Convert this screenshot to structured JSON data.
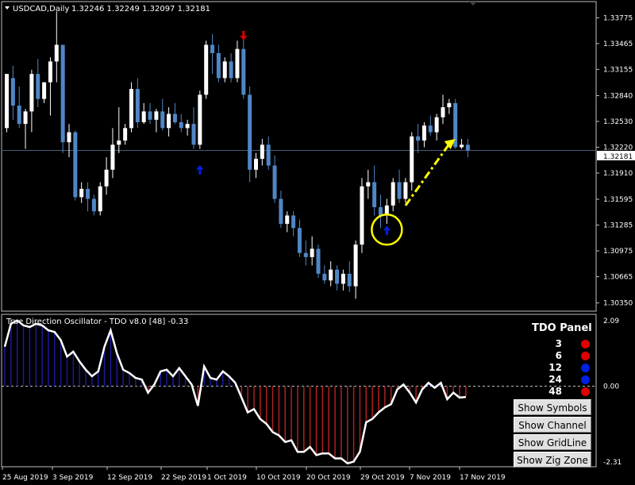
{
  "header": {
    "symbol": "USDCAD,Daily",
    "ohlc": "1.32246 1.32249 1.32097 1.32181"
  },
  "chart_data": [
    {
      "type": "candlestick",
      "title": "USDCAD,Daily",
      "ylim": [
        1.3027,
        1.3395
      ],
      "y_ticks": [
        "1.33775",
        "1.33465",
        "1.33155",
        "1.32840",
        "1.32530",
        "1.32220",
        "1.31910",
        "1.31595",
        "1.31285",
        "1.30975",
        "1.30665",
        "1.30350"
      ],
      "current_price": "1.32181",
      "x_ticks": [
        "25 Aug 2019",
        "3 Sep 2019",
        "12 Sep 2019",
        "22 Sep 2019",
        "1 Oct 2019",
        "10 Oct 2019",
        "20 Oct 2019",
        "29 Oct 2019",
        "7 Nov 2019",
        "17 Nov 2019"
      ],
      "candles": [
        [
          1.3245,
          1.3305,
          1.324,
          1.331
        ],
        [
          1.3305,
          1.332,
          1.3255,
          1.3272
        ],
        [
          1.3272,
          1.3295,
          1.3245,
          1.325
        ],
        [
          1.325,
          1.3268,
          1.322,
          1.3265
        ],
        [
          1.3265,
          1.3315,
          1.324,
          1.331
        ],
        [
          1.331,
          1.3328,
          1.327,
          1.328
        ],
        [
          1.328,
          1.33,
          1.3275,
          1.33
        ],
        [
          1.33,
          1.333,
          1.326,
          1.3325
        ],
        [
          1.3325,
          1.3385,
          1.33,
          1.3345
        ],
        [
          1.3345,
          1.3345,
          1.3215,
          1.3228
        ],
        [
          1.3228,
          1.325,
          1.321,
          1.324
        ],
        [
          1.324,
          1.3242,
          1.3158,
          1.3162
        ],
        [
          1.3162,
          1.318,
          1.3155,
          1.3172
        ],
        [
          1.3172,
          1.318,
          1.3145,
          1.316
        ],
        [
          1.316,
          1.3165,
          1.314,
          1.3145
        ],
        [
          1.3145,
          1.318,
          1.314,
          1.3175
        ],
        [
          1.3175,
          1.321,
          1.3165,
          1.3195
        ],
        [
          1.3195,
          1.3245,
          1.3185,
          1.3225
        ],
        [
          1.3225,
          1.327,
          1.3215,
          1.323
        ],
        [
          1.323,
          1.325,
          1.3225,
          1.3245
        ],
        [
          1.3245,
          1.33,
          1.324,
          1.3292
        ],
        [
          1.3292,
          1.3305,
          1.3245,
          1.3252
        ],
        [
          1.3252,
          1.3275,
          1.325,
          1.3265
        ],
        [
          1.3265,
          1.3275,
          1.325,
          1.3255
        ],
        [
          1.3255,
          1.3268,
          1.324,
          1.3265
        ],
        [
          1.3265,
          1.328,
          1.3242,
          1.3245
        ],
        [
          1.3245,
          1.327,
          1.3235,
          1.3262
        ],
        [
          1.3262,
          1.3275,
          1.325,
          1.3252
        ],
        [
          1.3252,
          1.3262,
          1.324,
          1.3245
        ],
        [
          1.3245,
          1.3255,
          1.3236,
          1.325
        ],
        [
          1.325,
          1.327,
          1.322,
          1.3225
        ],
        [
          1.3225,
          1.329,
          1.322,
          1.3285
        ],
        [
          1.3285,
          1.335,
          1.328,
          1.3345
        ],
        [
          1.3345,
          1.3358,
          1.331,
          1.3335
        ],
        [
          1.3335,
          1.3345,
          1.33,
          1.3305
        ],
        [
          1.3305,
          1.333,
          1.33,
          1.3325
        ],
        [
          1.3325,
          1.3335,
          1.33,
          1.3305
        ],
        [
          1.3305,
          1.335,
          1.33,
          1.334
        ],
        [
          1.334,
          1.3355,
          1.328,
          1.3285
        ],
        [
          1.3285,
          1.3295,
          1.318,
          1.3195
        ],
        [
          1.3195,
          1.3215,
          1.3185,
          1.3208
        ],
        [
          1.3208,
          1.3232,
          1.32,
          1.3225
        ],
        [
          1.3225,
          1.3235,
          1.3195,
          1.32
        ],
        [
          1.32,
          1.3212,
          1.3155,
          1.316
        ],
        [
          1.316,
          1.317,
          1.3125,
          1.313
        ],
        [
          1.313,
          1.3145,
          1.312,
          1.314
        ],
        [
          1.314,
          1.3145,
          1.3115,
          1.3125
        ],
        [
          1.3125,
          1.3135,
          1.309,
          1.3095
        ],
        [
          1.3095,
          1.311,
          1.308,
          1.309
        ],
        [
          1.309,
          1.3115,
          1.308,
          1.31
        ],
        [
          1.31,
          1.3105,
          1.3065,
          1.307
        ],
        [
          1.307,
          1.308,
          1.3058,
          1.3062
        ],
        [
          1.3062,
          1.3085,
          1.3055,
          1.3075
        ],
        [
          1.3075,
          1.308,
          1.305,
          1.3058
        ],
        [
          1.3058,
          1.3075,
          1.305,
          1.307
        ],
        [
          1.307,
          1.3085,
          1.3048,
          1.3055
        ],
        [
          1.3055,
          1.311,
          1.304,
          1.3105
        ],
        [
          1.3105,
          1.3185,
          1.3095,
          1.3175
        ],
        [
          1.3175,
          1.3195,
          1.316,
          1.318
        ],
        [
          1.318,
          1.32,
          1.314,
          1.315
        ],
        [
          1.315,
          1.3165,
          1.3125,
          1.314
        ],
        [
          1.314,
          1.316,
          1.313,
          1.3152
        ],
        [
          1.3152,
          1.3185,
          1.3145,
          1.318
        ],
        [
          1.318,
          1.3195,
          1.3155,
          1.316
        ],
        [
          1.316,
          1.3185,
          1.3155,
          1.318
        ],
        [
          1.318,
          1.324,
          1.317,
          1.3235
        ],
        [
          1.3235,
          1.325,
          1.3215,
          1.323
        ],
        [
          1.323,
          1.3252,
          1.3222,
          1.3248
        ],
        [
          1.3248,
          1.326,
          1.3236,
          1.324
        ],
        [
          1.324,
          1.3262,
          1.323,
          1.3258
        ],
        [
          1.3258,
          1.3285,
          1.325,
          1.327
        ],
        [
          1.327,
          1.328,
          1.3262,
          1.3275
        ],
        [
          1.3275,
          1.328,
          1.322,
          1.3222
        ],
        [
          1.3222,
          1.3232,
          1.322,
          1.3225
        ],
        [
          1.3225,
          1.3232,
          1.321,
          1.3218
        ]
      ],
      "colors": {
        "bull": "#ffffff",
        "bear": "#4f86c6",
        "grid": "#3a4a6a",
        "price_line": "#4a5a7a"
      },
      "annotations": [
        {
          "kind": "arrow-down",
          "color": "#e00000",
          "x_index": 38,
          "price": 1.3355
        },
        {
          "kind": "arrow-up",
          "color": "#0020e0",
          "x_index": 31,
          "price": 1.3196
        },
        {
          "kind": "arrow-up",
          "color": "#0020e0",
          "x_index": 61,
          "price": 1.3123
        },
        {
          "kind": "circle",
          "color": "#ffff00",
          "x_index": 61,
          "price": 1.3123
        },
        {
          "kind": "dash-arrow",
          "color": "#ffff00",
          "from": [
            64,
            1.3152
          ],
          "to": [
            72,
            1.3232
          ]
        }
      ]
    },
    {
      "type": "line",
      "title": "True Direction Oscillator - TDO v8.0 [48] -0.33",
      "ylim": [
        -2.31,
        2.09
      ],
      "y_ticks": [
        "2.09",
        "0.00",
        "-2.31"
      ],
      "zero_line": 0,
      "series": [
        {
          "values": [
            1.2,
            1.9,
            2.0,
            1.85,
            1.8,
            1.9,
            1.85,
            1.7,
            1.65,
            1.4,
            0.9,
            1.05,
            0.75,
            0.5,
            0.3,
            0.45,
            1.2,
            1.7,
            1.0,
            0.5,
            0.4,
            0.25,
            0.2,
            -0.2,
            0.05,
            0.45,
            0.5,
            0.3,
            0.55,
            0.3,
            0.05,
            -0.6,
            0.6,
            0.25,
            0.2,
            0.45,
            0.3,
            0.1,
            -0.35,
            -0.8,
            -0.7,
            -1.0,
            -1.15,
            -1.4,
            -1.5,
            -1.7,
            -1.65,
            -2.0,
            -2.0,
            -1.85,
            -2.1,
            -2.05,
            -2.05,
            -2.2,
            -2.2,
            -2.35,
            -2.3,
            -2.0,
            -1.1,
            -1.0,
            -0.8,
            -0.65,
            -0.55,
            -0.1,
            0.05,
            -0.2,
            -0.5,
            -0.1,
            0.1,
            -0.05,
            0.1,
            -0.4,
            -0.2,
            -0.35,
            -0.33
          ]
        }
      ],
      "histogram_colors": {
        "positive": "#1a1a9a",
        "negative": "#b02020"
      }
    }
  ],
  "tdo_panel": {
    "title": "TDO Panel",
    "rows": [
      {
        "period": "3",
        "color": "#e00000"
      },
      {
        "period": "6",
        "color": "#e00000"
      },
      {
        "period": "12",
        "color": "#0020e0"
      },
      {
        "period": "24",
        "color": "#0020e0"
      },
      {
        "period": "48",
        "color": "#e00000"
      }
    ]
  },
  "buttons": {
    "show_symbols": "Show Symbols",
    "show_channel": "Show Channel",
    "show_gridline": "Show GridLine",
    "show_zig_zone": "Show Zig Zone"
  }
}
